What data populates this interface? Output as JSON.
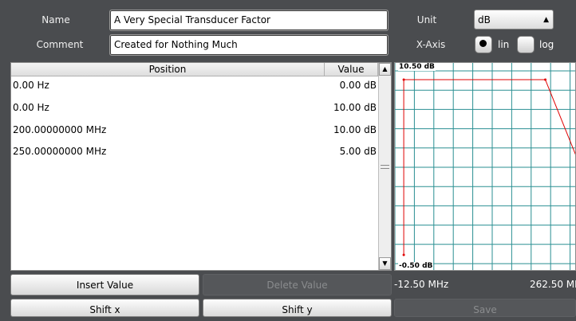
{
  "header": {
    "name_label": "Name",
    "name_value": "A Very Special Transducer Factor",
    "comment_label": "Comment",
    "comment_value": "Created for Nothing Much",
    "unit_label": "Unit",
    "unit_value": "dB",
    "xaxis_label": "X-Axis",
    "xaxis_options": [
      {
        "label": "lin",
        "selected": true
      },
      {
        "label": "log",
        "selected": false
      }
    ]
  },
  "table": {
    "columns": [
      "Position",
      "Value"
    ],
    "rows": [
      {
        "position": "0.00 Hz",
        "value": "0.00 dB"
      },
      {
        "position": "0.00 Hz",
        "value": "10.00 dB"
      },
      {
        "position": "200.00000000 MHz",
        "value": "10.00 dB"
      },
      {
        "position": "250.00000000 MHz",
        "value": "5.00 dB"
      }
    ]
  },
  "buttons": {
    "insert": "Insert Value",
    "delete": "Delete Value",
    "shift_x": "Shift x",
    "shift_y": "Shift y",
    "save": "Save"
  },
  "colors": {
    "line": "#e00000",
    "grid": "#2a8f92"
  },
  "chart_data": {
    "type": "line",
    "ytop_label": "10.50 dB",
    "ybottom_label": "-0.50 dB",
    "xmin_label": "-12.50 MHz",
    "xmax_label": "262.50 MHz",
    "xlim": [
      -12.5,
      262.5
    ],
    "ylim": [
      -0.5,
      10.5
    ],
    "series": [
      {
        "x": [
          0,
          0,
          200,
          250
        ],
        "y": [
          0,
          10,
          10,
          5
        ]
      }
    ]
  }
}
